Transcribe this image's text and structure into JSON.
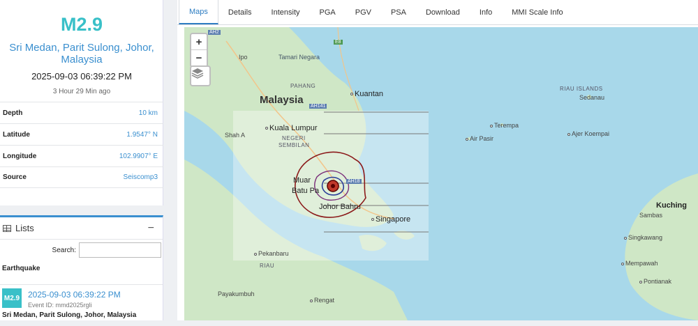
{
  "event": {
    "magnitude": "M2.9",
    "place": "Sri Medan, Parit Sulong, Johor, Malaysia",
    "datetime": "2025-09-03 06:39:22 PM",
    "ago": "3 Hour 29 Min ago",
    "details": [
      {
        "label": "Depth",
        "value": "10 km"
      },
      {
        "label": "Latitude",
        "value": "1.9547° N"
      },
      {
        "label": "Longitude",
        "value": "102.9907° E"
      },
      {
        "label": "Source",
        "value": "Seiscomp3"
      }
    ]
  },
  "lists": {
    "title": "Lists",
    "collapse": "−",
    "search_label": "Search:",
    "search_value": "",
    "column": "Earthquake",
    "items": [
      {
        "badge": "M2.9",
        "time": "2025-09-03 06:39:22 PM",
        "event_id": "Event ID: mmd2025rgli",
        "place": "Sri Medan, Parit Sulong, Johor, Malaysia"
      }
    ]
  },
  "tabs": [
    "Maps",
    "Details",
    "Intensity",
    "PGA",
    "PGV",
    "PSA",
    "Download",
    "Info",
    "MMI Scale Info"
  ],
  "map": {
    "zoom_in": "+",
    "zoom_out": "−",
    "labels": {
      "malaysia": "Malaysia",
      "kuala_lumpur": "Kuala Lumpur",
      "johor_bahru": "Johor Bahru",
      "singapore": "Singapore",
      "muar": "Muar",
      "batu_pahat": "Batu Pa",
      "kuantan": "Kuantan",
      "tamannegara": "Tamari Negara",
      "pahang": "PAHANG",
      "negeri": "NEGERI",
      "sembilan": "SEMBILAN",
      "shah_alam": "Shah A",
      "riau_islands": "RIAU ISLANDS",
      "sedanau": "Sedanau",
      "terempa": "Terempa",
      "ajer_koempai": "Ajer Koempai",
      "air_pasir": "Air Pasir",
      "kuching": "Kuching",
      "sambas": "Sambas",
      "singkawang": "Singkawang",
      "mempawah": "Mempawah",
      "pontianak": "Pontianak",
      "pekanbaru": "Pekanbaru",
      "riau": "RIAU",
      "payakumbuh": "Payakumbuh",
      "rengat": "Rengat",
      "ipoh": "Ipo",
      "ah2": "AH2",
      "ah141": "AH141",
      "e8": "E8",
      "ah18": "AH18"
    },
    "colors": {
      "land": "#cfe7c6",
      "sea": "#a8d8ea",
      "contour": "#8b1a1a",
      "epicenter": "#c0392b"
    }
  }
}
